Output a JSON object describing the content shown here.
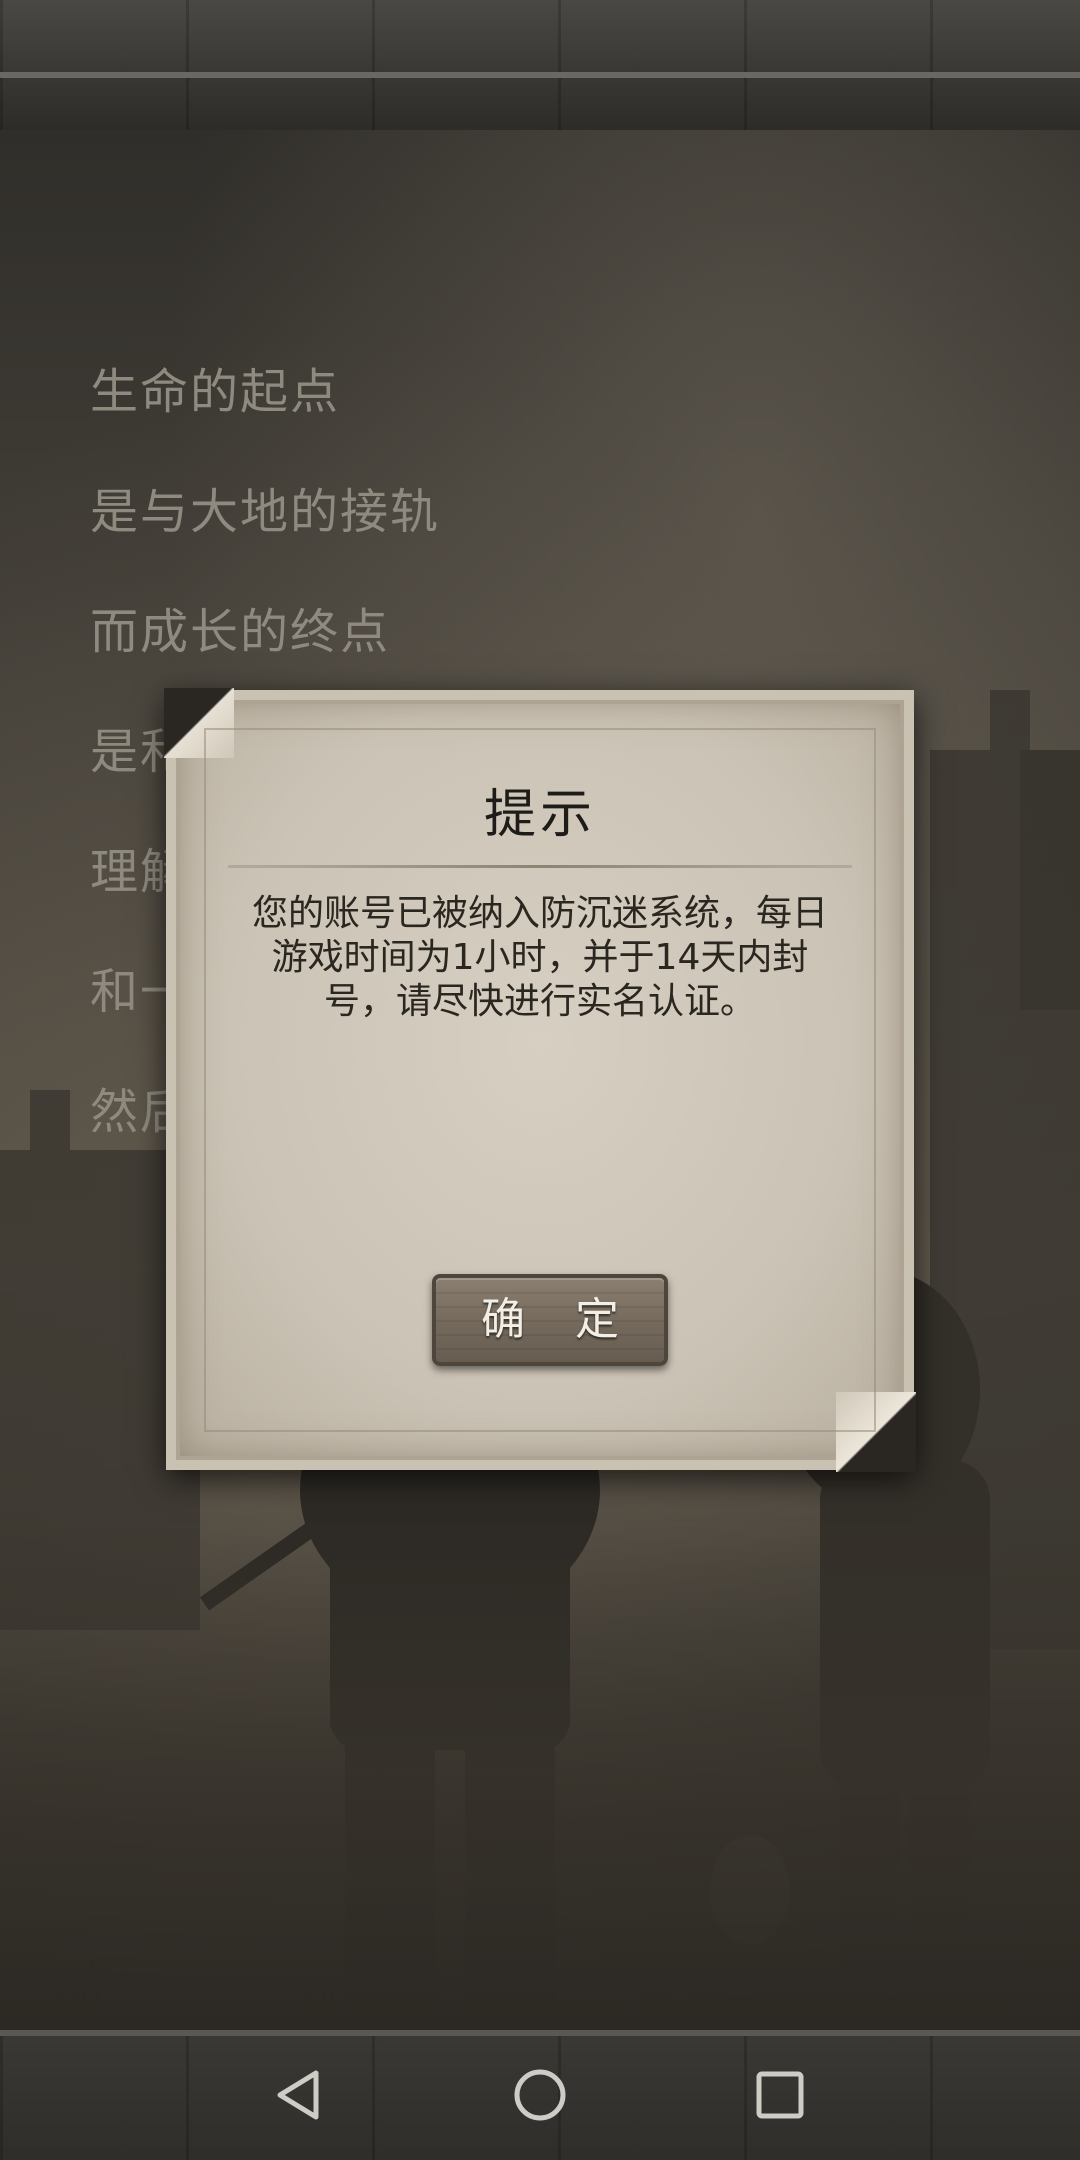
{
  "story": {
    "lines": [
      "生命的起点",
      "是与大地的接轨",
      "而成长的终点",
      "是和",
      "理解",
      "和一",
      "然后"
    ]
  },
  "dialog": {
    "title": "提示",
    "message": "您的账号已被纳入防沉迷系统，每日游戏时间为1小时，并于14天内封号，请尽快进行实名认证。",
    "confirm_label": "确 定"
  },
  "navbar": {
    "back_icon": "back-triangle-icon",
    "home_icon": "home-circle-icon",
    "recents_icon": "recents-square-icon"
  },
  "colors": {
    "story_text": "#8f8a80",
    "dialog_paper": "#cbc3b5",
    "button_wood": "#766b5d"
  }
}
